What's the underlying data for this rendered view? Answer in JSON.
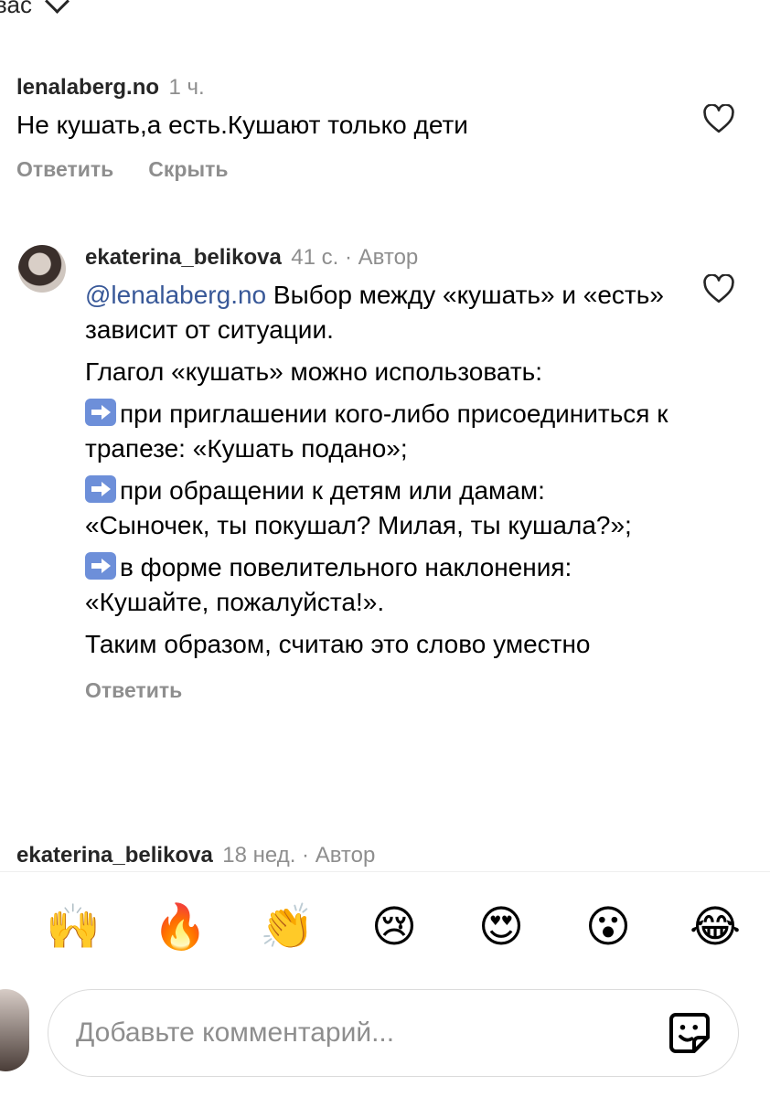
{
  "header": {
    "partial_text": "вас"
  },
  "comments": [
    {
      "username": "lenalaberg.no",
      "time": "1 ч.",
      "text": "Не кушать,а есть.Кушают только дети",
      "actions": [
        "Ответить",
        "Скрыть"
      ]
    },
    {
      "username": "ekaterina_belikova",
      "time": "41 с. · Автор",
      "mention": "@lenalaberg.no",
      "p1": " Выбор между «кушать» и «есть» зависит от ситуации.",
      "p2": "Глагол «кушать» можно  использовать:",
      "p3": "при приглашении кого-либо присоединиться к трапезе: «Кушать подано»;",
      "p4": "при обращении к детям или дамам: «Сыночек, ты покушал? Милая, ты кушала?»;",
      "p5": "в форме повелительного наклонения: «Кушайте, пожалуйста!».",
      "p6": "Таким образом, считаю это слово уместно",
      "reply": "Ответить"
    },
    {
      "username": "ekaterina_belikova",
      "time": "18 нед. · Автор"
    }
  ],
  "reactions": [
    "🙌",
    "🔥",
    "👏",
    "😢",
    "😍",
    "😮",
    "😂"
  ],
  "composer": {
    "placeholder": "Добавьте комментарий..."
  },
  "colors": {
    "mention": "#385898",
    "muted": "#8e8e8e",
    "arrow_emoji": "#6d8fd9"
  },
  "icons": [
    "chevron-down-icon",
    "heart-icon",
    "arrow-right-emoji-icon",
    "sticker-icon"
  ]
}
